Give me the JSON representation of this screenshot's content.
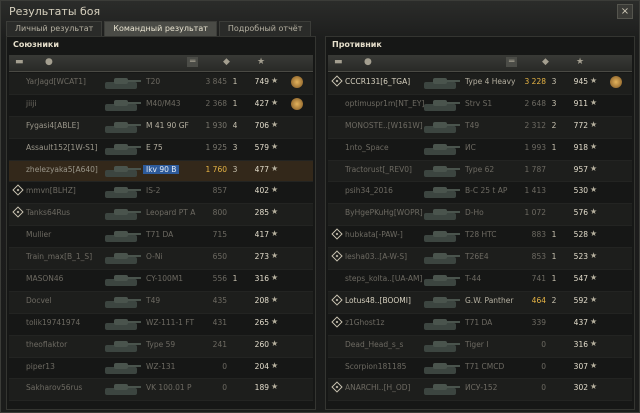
{
  "window": {
    "title": "Результаты боя",
    "close_glyph": "×"
  },
  "tabs": [
    "Личный результат",
    "Командный результат",
    "Подробный отчёт"
  ],
  "active_tab": 1,
  "left": {
    "title": "Союзники",
    "rows": [
      {
        "player": "YarJagd[WCAT1]",
        "tank": "T20",
        "dmg": "3 845",
        "kills": "1",
        "xp": "749",
        "medal": true,
        "dead": true
      },
      {
        "player": "jiiji",
        "tank": "M40/M43",
        "dmg": "2 368",
        "kills": "1",
        "xp": "427",
        "medal": true,
        "dead": true
      },
      {
        "player": "Fygasi4[ABLE]",
        "tank": "M 41 90 GF",
        "dmg": "1 930",
        "kills": "4",
        "xp": "706"
      },
      {
        "player": "Assault152[1W-S1]",
        "tank": "E 75",
        "dmg": "1 925",
        "kills": "3",
        "xp": "579"
      },
      {
        "player": "zhelezyaka5[A640]",
        "tank": "Ikv 90 B",
        "dmg": "1 760",
        "kills": "3",
        "xp": "477",
        "self": true,
        "gold": true,
        "hl": true
      },
      {
        "player": "mmvn[BLHZ]",
        "tank": "IS-2",
        "dmg": "857",
        "kills": "",
        "xp": "402",
        "mark": true,
        "dead": true
      },
      {
        "player": "Tanks64Rus",
        "tank": "Leopard PT A",
        "dmg": "800",
        "kills": "",
        "xp": "285",
        "mark": true,
        "dead": true
      },
      {
        "player": "Mullier",
        "tank": "T71 DA",
        "dmg": "715",
        "kills": "",
        "xp": "417",
        "dead": true
      },
      {
        "player": "Train_max[B_1_S]",
        "tank": "O-Ni",
        "dmg": "650",
        "kills": "",
        "xp": "273",
        "dead": true
      },
      {
        "player": "MASON46",
        "tank": "CY-100M1",
        "dmg": "556",
        "kills": "1",
        "xp": "316",
        "dead": true
      },
      {
        "player": "Docvel",
        "tank": "T49",
        "dmg": "435",
        "kills": "",
        "xp": "208",
        "dead": true
      },
      {
        "player": "tolik19741974",
        "tank": "WZ-111-1 FT",
        "dmg": "431",
        "kills": "",
        "xp": "265",
        "dead": true
      },
      {
        "player": "theoflaktor",
        "tank": "Type 59",
        "dmg": "241",
        "kills": "",
        "xp": "260",
        "dead": true
      },
      {
        "player": "piper13",
        "tank": "WZ-131",
        "dmg": "0",
        "kills": "",
        "xp": "204",
        "dead": true
      },
      {
        "player": "Sakharov56rus",
        "tank": "VK 100.01 P",
        "dmg": "0",
        "kills": "",
        "xp": "189",
        "dead": true
      }
    ]
  },
  "right": {
    "title": "Противник",
    "rows": [
      {
        "player": "CCCR131[6_TGA]",
        "tank": "Type 4 Heavy",
        "dmg": "3 228",
        "kills": "3",
        "xp": "945",
        "medal": true,
        "mark": true,
        "bright": true,
        "gold": true
      },
      {
        "player": "optimuspr1m[NT_EY]",
        "tank": "Strv S1",
        "dmg": "2 648",
        "kills": "3",
        "xp": "911",
        "dead": true
      },
      {
        "player": "MONOSTE..[W161W]",
        "tank": "T49",
        "dmg": "2 312",
        "kills": "2",
        "xp": "772",
        "dead": true
      },
      {
        "player": "1nto_Space",
        "tank": "ИС",
        "dmg": "1 993",
        "kills": "1",
        "xp": "918",
        "dead": true
      },
      {
        "player": "Tractorust[_REV0]",
        "tank": "Type 62",
        "dmg": "1 787",
        "kills": "",
        "xp": "957",
        "dead": true
      },
      {
        "player": "psih34_2016",
        "tank": "B-C 25 t AP",
        "dmg": "1 413",
        "kills": "",
        "xp": "530",
        "dead": true
      },
      {
        "player": "ByHgePKuHg[WOPR]",
        "tank": "D-Ho",
        "dmg": "1 072",
        "kills": "",
        "xp": "576",
        "dead": true
      },
      {
        "player": "hubkata[-PAW-]",
        "tank": "T28 HTC",
        "dmg": "883",
        "kills": "1",
        "xp": "528",
        "mark": true,
        "dead": true
      },
      {
        "player": "lesha03..[A-W-S]",
        "tank": "T26E4",
        "dmg": "853",
        "kills": "1",
        "xp": "523",
        "mark": true,
        "dead": true
      },
      {
        "player": "steps_kolta..[UA-AM]",
        "tank": "T-44",
        "dmg": "741",
        "kills": "1",
        "xp": "547",
        "dead": true
      },
      {
        "player": "Lotus48..[BOOMI]",
        "tank": "G.W. Panther",
        "dmg": "464",
        "kills": "2",
        "xp": "592",
        "mark": true,
        "bright": true,
        "gold": true
      },
      {
        "player": "z1Ghost1z",
        "tank": "T71 DA",
        "dmg": "339",
        "kills": "",
        "xp": "437",
        "mark": true,
        "dead": true
      },
      {
        "player": "Dead_Head_s_s",
        "tank": "Tiger I",
        "dmg": "0",
        "kills": "",
        "xp": "316",
        "dead": true
      },
      {
        "player": "Scorpion181185",
        "tank": "T71 CMCD",
        "dmg": "0",
        "kills": "",
        "xp": "307",
        "dead": true
      },
      {
        "player": "ANARCHI..[H_OD]",
        "tank": "ИСУ-152",
        "dmg": "0",
        "kills": "",
        "xp": "302",
        "mark": true,
        "dead": true
      }
    ]
  },
  "icons": {
    "xp_star": "★",
    "header_icons": [
      "squad-icon",
      "player-icon",
      "damage-icon",
      "kills-icon",
      "xp-icon"
    ]
  }
}
